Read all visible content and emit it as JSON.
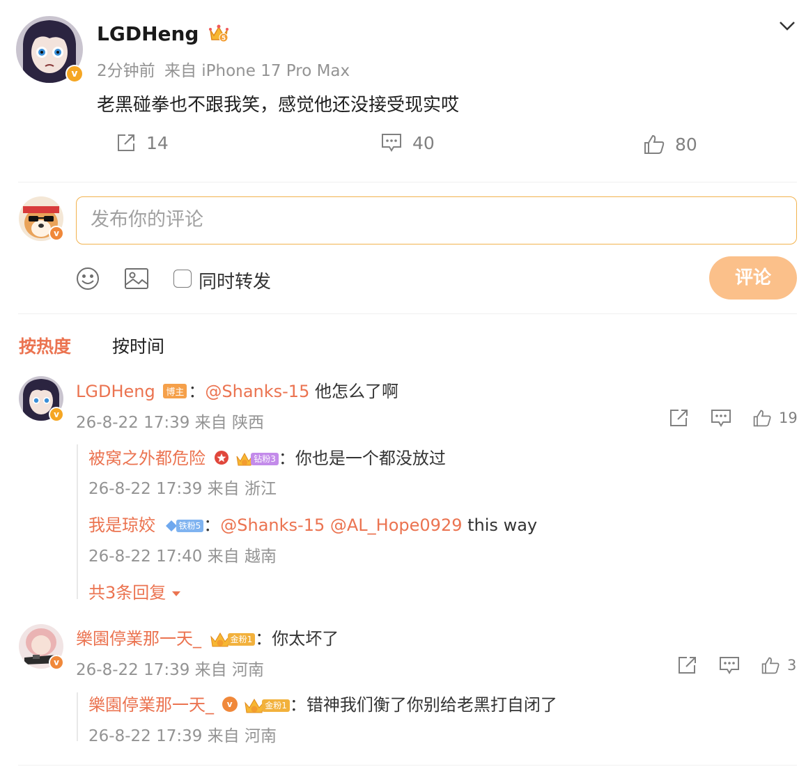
{
  "post": {
    "author": "LGDHeng",
    "time": "2分钟前",
    "source": "来自 iPhone 17 Pro Max",
    "text": "老黑碰拳也不跟我笑，感觉他还没接受现实哎",
    "reposts": "14",
    "comments": "40",
    "likes": "80"
  },
  "composer": {
    "placeholder": "发布你的评论",
    "repost_label": "同时转发",
    "submit_label": "评论"
  },
  "sort_tabs": {
    "hot": "按热度",
    "time": "按时间"
  },
  "comments": [
    {
      "author": "LGDHeng",
      "author_tag": "博主",
      "text_mention": "@Shanks-15",
      "text": "他怎么了啊",
      "meta": "26-8-22 17:39 来自 陕西",
      "likes": "19",
      "replies": [
        {
          "author": "被窝之外都危险",
          "fan_badge": "钻粉3",
          "text": "你也是一个都没放过",
          "meta": "26-8-22 17:39 来自 浙江"
        },
        {
          "author": "我是琼姣",
          "fan_badge": "铁粉5",
          "mention1": "@Shanks-15",
          "mention2": "@AL_Hope0929",
          "text": "this way",
          "meta": "26-8-22 17:40 来自 越南"
        }
      ],
      "more_replies": "共3条回复"
    },
    {
      "author": "樂園停業那一天_",
      "fan_badge": "金粉1",
      "text": "你太坏了",
      "meta": "26-8-22 17:39 来自 河南",
      "likes": "3",
      "replies": [
        {
          "author": "樂園停業那一天_",
          "fan_badge": "金粉1",
          "text": "错神我们衡了你别给老黑打自闭了",
          "meta": "26-8-22 17:39 来自 河南"
        }
      ]
    }
  ],
  "colors": {
    "accent": "#eb7350",
    "input_border": "#f2b24e",
    "submit_bg": "#fbc08a",
    "verified": "#f5a623"
  }
}
